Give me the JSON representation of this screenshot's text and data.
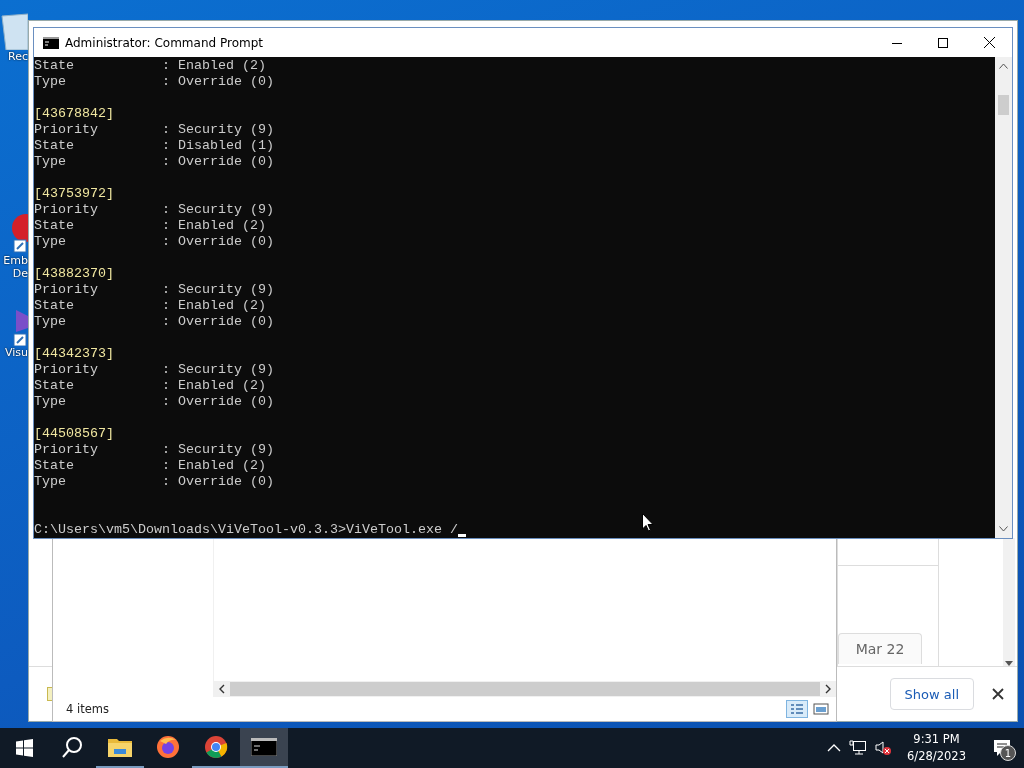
{
  "desktop_icons": [
    {
      "kind": "recycle",
      "label": "Rec"
    },
    {
      "kind": "embarcadero",
      "label": "Emb",
      "label_2": "De"
    },
    {
      "kind": "visual",
      "label": "Visu"
    }
  ],
  "browser": {
    "tab": "Mar 22",
    "download_bar": {
      "show_all": "Show all"
    }
  },
  "explorer": {
    "status": "4 items",
    "views": [
      {
        "kind": "details",
        "selected": true
      },
      {
        "kind": "preview",
        "selected": false
      }
    ]
  },
  "console": {
    "title": "Administrator:  Command Prompt",
    "lines": [
      {
        "kind": "field",
        "text": "State           : Enabled (2)"
      },
      {
        "kind": "field",
        "text": "Type            : Override (0)"
      },
      {
        "kind": "blank"
      },
      {
        "kind": "id",
        "text": "[43678842]"
      },
      {
        "kind": "field",
        "text": "Priority        : Security (9)"
      },
      {
        "kind": "field",
        "text": "State           : Disabled (1)"
      },
      {
        "kind": "field",
        "text": "Type            : Override (0)"
      },
      {
        "kind": "blank"
      },
      {
        "kind": "id",
        "text": "[43753972]"
      },
      {
        "kind": "field",
        "text": "Priority        : Security (9)"
      },
      {
        "kind": "field",
        "text": "State           : Enabled (2)"
      },
      {
        "kind": "field",
        "text": "Type            : Override (0)"
      },
      {
        "kind": "blank"
      },
      {
        "kind": "id",
        "text": "[43882370]"
      },
      {
        "kind": "field",
        "text": "Priority        : Security (9)"
      },
      {
        "kind": "field",
        "text": "State           : Enabled (2)"
      },
      {
        "kind": "field",
        "text": "Type            : Override (0)"
      },
      {
        "kind": "blank"
      },
      {
        "kind": "id",
        "text": "[44342373]"
      },
      {
        "kind": "field",
        "text": "Priority        : Security (9)"
      },
      {
        "kind": "field",
        "text": "State           : Enabled (2)"
      },
      {
        "kind": "field",
        "text": "Type            : Override (0)"
      },
      {
        "kind": "blank"
      },
      {
        "kind": "id",
        "text": "[44508567]"
      },
      {
        "kind": "field",
        "text": "Priority        : Security (9)"
      },
      {
        "kind": "field",
        "text": "State           : Enabled (2)"
      },
      {
        "kind": "field",
        "text": "Type            : Override (0)"
      },
      {
        "kind": "blank"
      },
      {
        "kind": "blank"
      },
      {
        "kind": "prompt",
        "text": "C:\\Users\\vm5\\Downloads\\ViVeTool-v0.3.3>ViVeTool.exe /"
      }
    ]
  },
  "taskbar": {
    "apps": [
      {
        "kind": "explorer",
        "running": true,
        "selected": false
      },
      {
        "kind": "firefox",
        "running": false,
        "selected": false
      },
      {
        "kind": "chrome",
        "running": true,
        "selected": false
      },
      {
        "kind": "cmd",
        "running": true,
        "selected": true
      }
    ],
    "time": "9:31 PM",
    "date": "6/28/2023",
    "notifications": "1"
  }
}
